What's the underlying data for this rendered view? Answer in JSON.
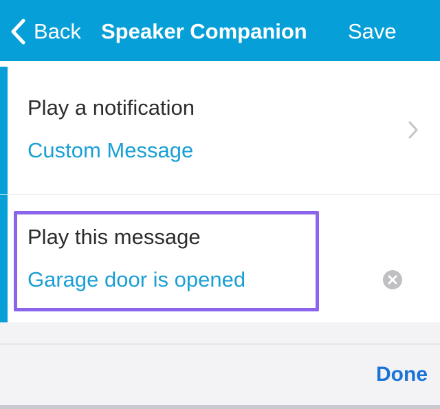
{
  "nav": {
    "back_label": "Back",
    "title": "Speaker Companion",
    "save_label": "Save",
    "background_color": "#079fd8",
    "icons": {
      "back": "chevron-left-icon"
    }
  },
  "rows": [
    {
      "title": "Play a notification",
      "value": "Custom Message",
      "icon": "chevron-right-icon"
    },
    {
      "title": "Play this message",
      "value": "Garage door is opened",
      "icon": "clear-icon",
      "highlight_color": "#8a64ea"
    }
  ],
  "keyboard_toolbar": {
    "done_label": "Done",
    "done_color": "#1a73d9"
  },
  "colors": {
    "accent": "#079fd8",
    "value_text": "#1a9fd4",
    "title_text": "#2c2c2c"
  }
}
